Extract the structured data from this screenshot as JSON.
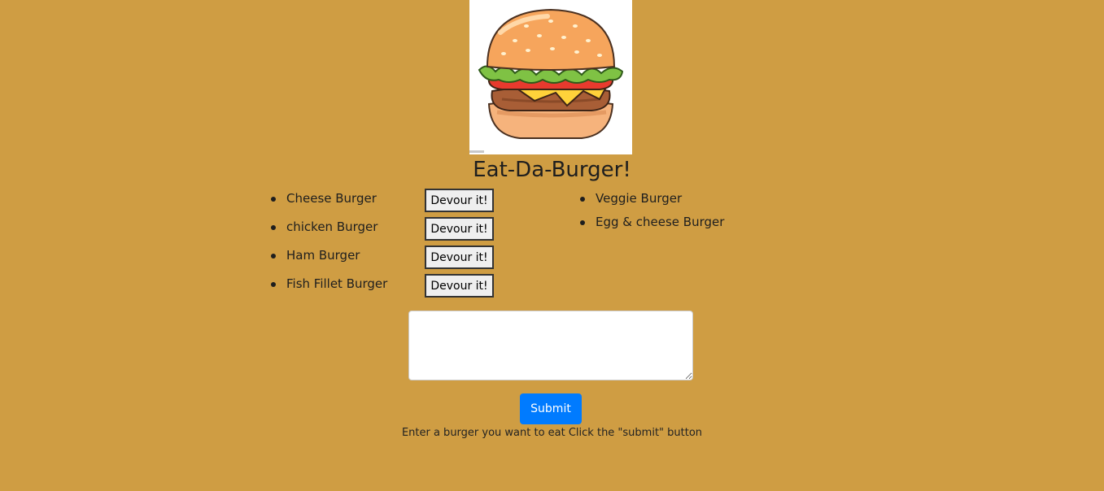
{
  "page": {
    "title": "Eat-Da-Burger!"
  },
  "hero": {
    "icon": "burger-image"
  },
  "uneaten": [
    {
      "name": "Cheese Burger",
      "button": "Devour it!"
    },
    {
      "name": "chicken Burger",
      "button": "Devour it!"
    },
    {
      "name": "Ham Burger",
      "button": "Devour it!"
    },
    {
      "name": "Fish Fillet Burger",
      "button": "Devour it!"
    }
  ],
  "devoured": [
    {
      "name": "Veggie Burger"
    },
    {
      "name": "Egg & cheese Burger"
    }
  ],
  "form": {
    "value": "",
    "submit_label": "Submit",
    "hint": "Enter a burger you want to eat Click the \"submit\" button"
  },
  "colors": {
    "background": "#cf9d43",
    "submit": "#007bff"
  }
}
